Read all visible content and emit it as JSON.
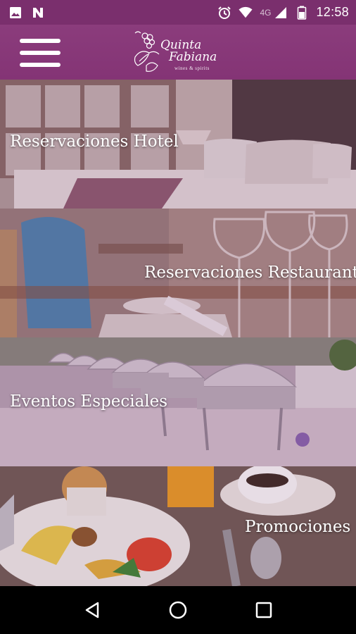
{
  "status_bar": {
    "time": "12:58",
    "network_label": "4G",
    "icons": [
      "image-icon",
      "n-notification-icon",
      "alarm-icon",
      "wifi-icon",
      "signal-icon",
      "battery-icon"
    ]
  },
  "app_bar": {
    "logo_line_1": "Quinta",
    "logo_line_2": "Fabiana",
    "logo_sub": "wines & spirits",
    "menu_icon": "hamburger-menu-icon"
  },
  "tiles": [
    {
      "label": "Reservaciones Hotel"
    },
    {
      "label": "Reservaciones Restaurante"
    },
    {
      "label": "Eventos Especiales"
    },
    {
      "label": "Promociones"
    }
  ],
  "nav_bar": {
    "icons": [
      "back-icon",
      "home-icon",
      "recents-icon"
    ]
  },
  "colors": {
    "brand": "#843475",
    "status_bar": "#7a2f6d",
    "overlay": "#6a2b5e"
  }
}
